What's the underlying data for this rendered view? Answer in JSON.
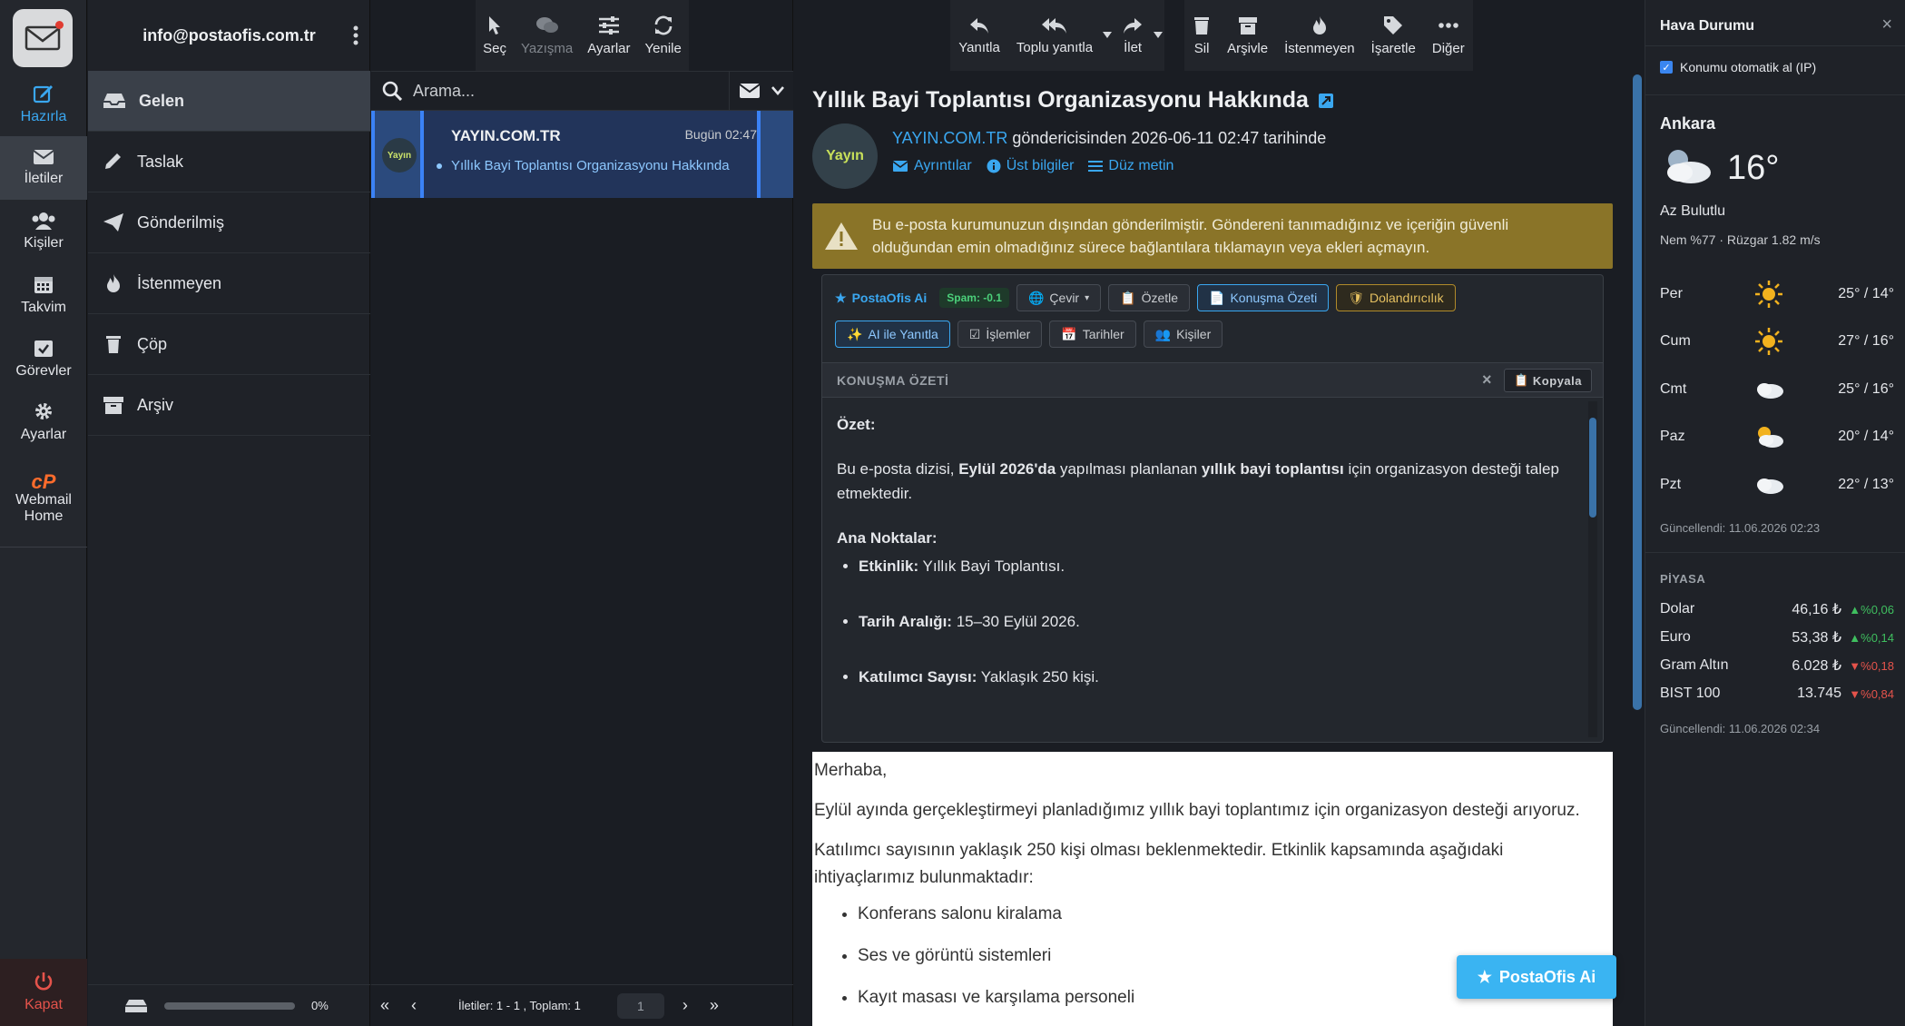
{
  "rail": {
    "items": [
      {
        "label": "Hazırla",
        "icon": "compose-icon"
      },
      {
        "label": "İletiler",
        "icon": "mail-icon"
      },
      {
        "label": "Kişiler",
        "icon": "contacts-icon"
      },
      {
        "label": "Takvim",
        "icon": "calendar-icon"
      },
      {
        "label": "Görevler",
        "icon": "tasks-icon"
      },
      {
        "label": "Ayarlar",
        "icon": "gear-icon"
      },
      {
        "label": "Webmail Home",
        "icon": "cpanel-icon"
      }
    ],
    "logout": "Kapat"
  },
  "account": {
    "email": "info@postaofis.com.tr"
  },
  "folders": [
    {
      "label": "Gelen",
      "icon": "inbox-icon"
    },
    {
      "label": "Taslak",
      "icon": "pencil-icon"
    },
    {
      "label": "Gönderilmiş",
      "icon": "send-icon"
    },
    {
      "label": "İstenmeyen",
      "icon": "fire-icon"
    },
    {
      "label": "Çöp",
      "icon": "trash-icon"
    },
    {
      "label": "Arşiv",
      "icon": "archive-icon"
    }
  ],
  "quota": {
    "percent_label": "0%",
    "fraction": 0.0
  },
  "list_toolbar": {
    "select": "Seç",
    "thread": "Yazışma",
    "options": "Ayarlar",
    "refresh": "Yenile"
  },
  "search": {
    "placeholder": "Arama..."
  },
  "message": {
    "from": "YAYIN.COM.TR",
    "date": "Bugün 02:47",
    "subject": "Yıllık Bayi Toplantısı Organizasyonu Hakkında",
    "avatar_text": "Yayın"
  },
  "list_footer": {
    "count": "İletiler: 1 - 1 , Toplam: 1",
    "page": "1"
  },
  "read_toolbar": {
    "reply": "Yanıtla",
    "reply_all": "Toplu yanıtla",
    "forward": "İlet",
    "delete": "Sil",
    "archive": "Arşivle",
    "junk": "İstenmeyen",
    "mark": "İşaretle",
    "more": "Diğer"
  },
  "email": {
    "subject": "Yıllık Bayi Toplantısı Organizasyonu Hakkında",
    "sender_link": "YAYIN.COM.TR",
    "sender_rest": " göndericisinden 2026-06-11 02:47 tarihinde",
    "links": {
      "details": "Ayrıntılar",
      "headers": "Üst bilgiler",
      "plain": "Düz metin"
    },
    "warning_1": "Bu e-posta kurumunuzun dışından gönderilmiştir. Göndereni tanımadığınız ve içeriğin güvenli",
    "warning_2": "olduğundan emin olmadığınız sürece bağlantılara tıklamayın veya ekleri açmayın."
  },
  "ai": {
    "brand": "PostaOfis Ai",
    "spam": "Spam: -0.1",
    "translate": "Çevir",
    "summarize": "Özetle",
    "conv_summary": "Konuşma Özeti",
    "fraud": "Dolandırıcılık",
    "reply_ai": "AI ile Yanıtla",
    "actions": "İşlemler",
    "dates": "Tarihler",
    "people": "Kişiler",
    "summary_title": "KONUŞMA ÖZETİ",
    "copy": "Kopyala",
    "ozet_label": "Özet:",
    "ozet_pre": "Bu e-posta dizisi, ",
    "ozet_b1": "Eylül 2026'da",
    "ozet_mid": " yapılması planlanan ",
    "ozet_b2": "yıllık bayi toplantısı",
    "ozet_post": " için organizasyon desteği talep etmektedir.",
    "points_label": "Ana Noktalar:",
    "points": [
      {
        "k": "Etkinlik:",
        "v": " Yıllık Bayi Toplantısı."
      },
      {
        "k": "Tarih Aralığı:",
        "v": " 15–30 Eylül 2026."
      },
      {
        "k": "Katılımcı Sayısı:",
        "v": " Yaklaşık 250 kişi."
      }
    ]
  },
  "body": {
    "greeting": "Merhaba,",
    "p1": "Eylül ayında gerçekleştirmeyi planladığımız yıllık bayi toplantımız için organizasyon desteği arıyoruz.",
    "p2a": "Katılımcı sayısının yaklaşık 250 kişi olması beklenmektedir. Etkinlik kapsamında aşağıdaki",
    "p2b": "ihtiyaçlarımız bulunmaktadır:",
    "items": [
      "Konferans salonu kiralama",
      "Ses ve görüntü sistemleri",
      "Kayıt masası ve karşılama personeli"
    ]
  },
  "ai_button": "PostaOfis Ai",
  "weather": {
    "title": "Hava Durumu",
    "autoloc": "Konumu otomatik al (IP)",
    "city": "Ankara",
    "temp": "16°",
    "condition": "Az Bulutlu",
    "humid": "Nem %77 · Rüzgar 1.82 m/s",
    "forecast": [
      {
        "day": "Per",
        "icon": "sun-icon",
        "temp": "25° / 14°"
      },
      {
        "day": "Cum",
        "icon": "sun-icon",
        "temp": "27° / 16°"
      },
      {
        "day": "Cmt",
        "icon": "cloud-icon",
        "temp": "25° / 16°"
      },
      {
        "day": "Paz",
        "icon": "sun-cloud-icon",
        "temp": "20° / 14°"
      },
      {
        "day": "Pzt",
        "icon": "cloud-icon",
        "temp": "22° / 13°"
      }
    ],
    "updated": "Güncellendi: 11.06.2026 02:23"
  },
  "market": {
    "title": "PİYASA",
    "rows": [
      {
        "name": "Dolar",
        "value": "46,16 ₺",
        "change": "▲%0,06",
        "dir": "up"
      },
      {
        "name": "Euro",
        "value": "53,38 ₺",
        "change": "▲%0,14",
        "dir": "up"
      },
      {
        "name": "Gram Altın",
        "value": "6.028 ₺",
        "change": "▼%0,18",
        "dir": "dn"
      },
      {
        "name": "BIST 100",
        "value": "13.745",
        "change": "▼%0,84",
        "dir": "dn"
      }
    ],
    "updated": "Güncellendi: 11.06.2026 02:34"
  },
  "colors": {
    "accent": "#3aa7f0",
    "warning": "#8a7428",
    "selected_row": "#22345a"
  }
}
